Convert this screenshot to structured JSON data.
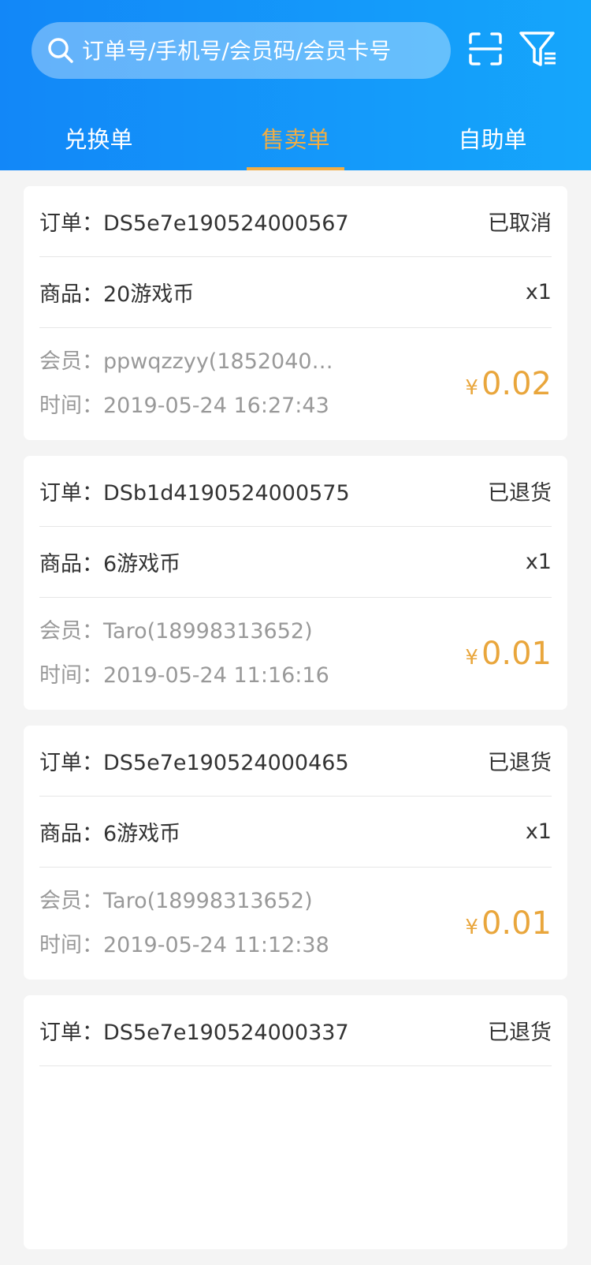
{
  "header": {
    "search_placeholder": "订单号/手机号/会员码/会员卡号",
    "tabs": [
      "兑换单",
      "售卖单",
      "自助单"
    ],
    "active_tab": 1,
    "colors": {
      "accent": "#f2ad43",
      "header_start": "#1287f8",
      "header_end": "#15a6fb"
    }
  },
  "labels": {
    "order": "订单：",
    "product": "商品：",
    "member": "会员：",
    "time": "时间：",
    "currency": "¥"
  },
  "orders": [
    {
      "order_no": "DS5e7e190524000567",
      "status": "已取消",
      "product": "20游戏币",
      "qty": "x1",
      "member": "ppwqzzyy(18520405...",
      "time": "2019-05-24 16:27:43",
      "price": "0.02"
    },
    {
      "order_no": "DSb1d4190524000575",
      "status": "已退货",
      "product": "6游戏币",
      "qty": "x1",
      "member": "Taro(18998313652)",
      "time": "2019-05-24 11:16:16",
      "price": "0.01"
    },
    {
      "order_no": "DS5e7e190524000465",
      "status": "已退货",
      "product": "6游戏币",
      "qty": "x1",
      "member": "Taro(18998313652)",
      "time": "2019-05-24 11:12:38",
      "price": "0.01"
    },
    {
      "order_no": "DS5e7e190524000337",
      "status": "已退货"
    }
  ]
}
